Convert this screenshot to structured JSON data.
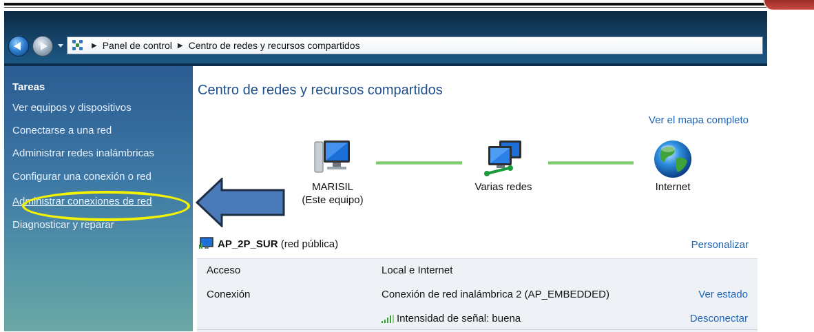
{
  "breadcrumb": {
    "items": [
      "Panel de control",
      "Centro de redes y recursos compartidos"
    ]
  },
  "sidebar": {
    "heading": "Tareas",
    "items": [
      {
        "label": "Ver equipos y dispositivos"
      },
      {
        "label": "Conectarse a una red"
      },
      {
        "label": "Administrar redes inalámbricas"
      },
      {
        "label": "Configurar una conexión o red"
      },
      {
        "label": "Administrar conexiones de red",
        "highlighted": true
      },
      {
        "label": "Diagnosticar y reparar"
      }
    ]
  },
  "main": {
    "title": "Centro de redes y recursos compartidos",
    "map_link": "Ver el mapa completo",
    "nodes": [
      {
        "name": "MARISIL",
        "subtitle": "(Este equipo)",
        "icon": "computer-icon"
      },
      {
        "name": "Varias redes",
        "icon": "multiple-networks-icon"
      },
      {
        "name": "Internet",
        "icon": "globe-icon"
      }
    ],
    "network": {
      "name": "AP_2P_SUR",
      "type": "(red pública)",
      "customize_link": "Personalizar",
      "rows": [
        {
          "label": "Acceso",
          "value": "Local e Internet",
          "action": ""
        },
        {
          "label": "Conexión",
          "value": "Conexión de red inalámbrica 2 (AP_EMBEDDED)",
          "action": "Ver estado"
        },
        {
          "label": "",
          "value": "Intensidad de señal: buena",
          "action": "Desconectar"
        }
      ]
    }
  },
  "colors": {
    "sidebar_top": "#2b5c92",
    "sidebar_bottom": "#6aa7a4",
    "highlight": "#f3f300",
    "arrow_fill": "#4a7ab8",
    "link": "#1f64b4",
    "title": "#1f4f8a"
  }
}
